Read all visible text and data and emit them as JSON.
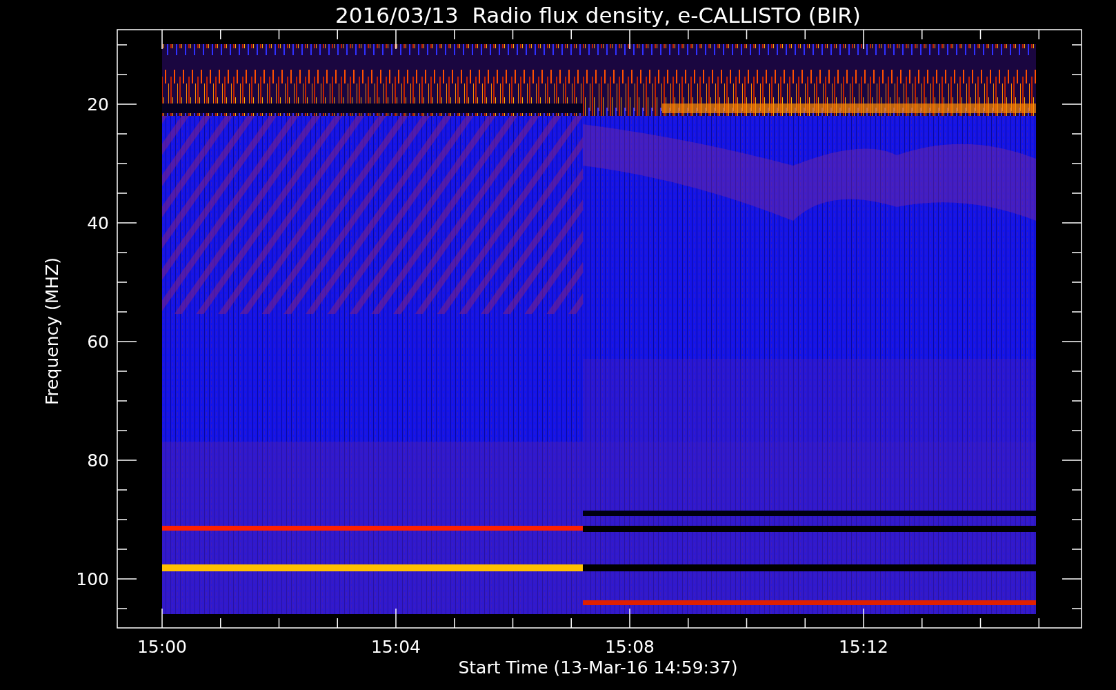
{
  "title": "2016/03/13  Radio flux density, e-CALLISTO (BIR)",
  "y_axis": {
    "label": "Frequency (MHZ)",
    "ticks": [
      "20",
      "40",
      "60",
      "80",
      "100"
    ]
  },
  "x_axis": {
    "label": "Start Time (13-Mar-16 14:59:37)",
    "ticks": [
      "15:00",
      "15:04",
      "15:08",
      "15:12"
    ]
  }
}
